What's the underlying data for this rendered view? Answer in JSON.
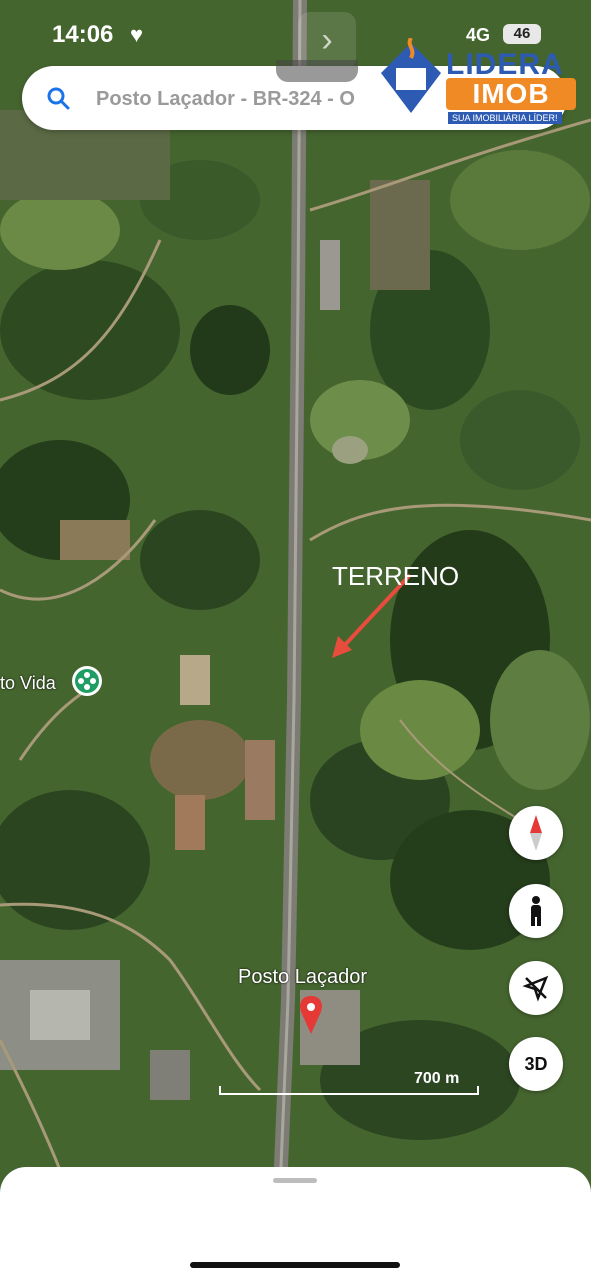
{
  "status_bar": {
    "time": "14:06",
    "network": "4G",
    "battery": "46"
  },
  "search": {
    "query": "Posto Laçador - BR-324 - O"
  },
  "watermark": {
    "brand_top": "LIDERA",
    "brand_bottom": "IMOB",
    "tagline": "SUA IMOBILIÁRIA LÍDER!"
  },
  "map": {
    "annotation": "TERRENO",
    "place_label": "Posto Laçador",
    "poi_label": "to Vida",
    "scale_label": "700 m",
    "icons": [
      "search-icon",
      "compass-icon",
      "street-view-person-icon",
      "location-off-icon",
      "map-pin-icon",
      "poi-flower-icon"
    ],
    "colors": {
      "pin": "#e53935",
      "arrow": "#e74c3c",
      "poi": "#1f9d63",
      "compass_north": "#e53935"
    }
  },
  "controls": {
    "mode_3d": "3D"
  }
}
